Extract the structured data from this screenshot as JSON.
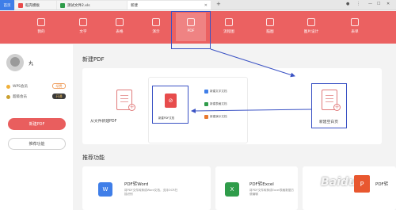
{
  "tabs": {
    "home": "首页",
    "items": [
      {
        "label": "稻壳模板",
        "color": "#e84a4a"
      },
      {
        "label": "测试文件2.xls",
        "color": "#2f9c4a"
      },
      {
        "label": "新建",
        "color": "#ffffff"
      }
    ],
    "new_tab": "+"
  },
  "toolbar": {
    "items": [
      "我的",
      "文字",
      "表格",
      "演示",
      "PDF",
      "流程图",
      "脑图",
      "图片设计",
      "表单"
    ],
    "active": "PDF",
    "bg": "#eb6161"
  },
  "user": {
    "name": "丸",
    "wps_member": "WPS会员",
    "wps_btn": "续费",
    "super_member": "超级会员",
    "super_btn": "开通"
  },
  "sidebar": {
    "new_pdf": "新建PDF",
    "recommend": "推荐功能"
  },
  "main": {
    "new_title": "新建PDF",
    "from_file": "从文件新建PDF",
    "new_blank": "新建空白页",
    "mid_label": "新建PDF文档",
    "mid_options": [
      "新建文字文档",
      "新建表格文档",
      "新建演示文档"
    ],
    "recommend_title": "推荐功能",
    "rec": [
      {
        "title": "PDF转Word",
        "desc": "将PDF文件转换成Word文档，支持OCR扫描识别",
        "color": "#3f7ee8",
        "icon": "W"
      },
      {
        "title": "PDF转Excel",
        "desc": "将PDF文件转换成Excel表格数据方便编辑",
        "color": "#2f9c4a",
        "icon": "X"
      },
      {
        "title": "PDF转",
        "desc": "",
        "color": "#e8572f",
        "icon": "P"
      }
    ]
  },
  "watermark": "Baidu"
}
